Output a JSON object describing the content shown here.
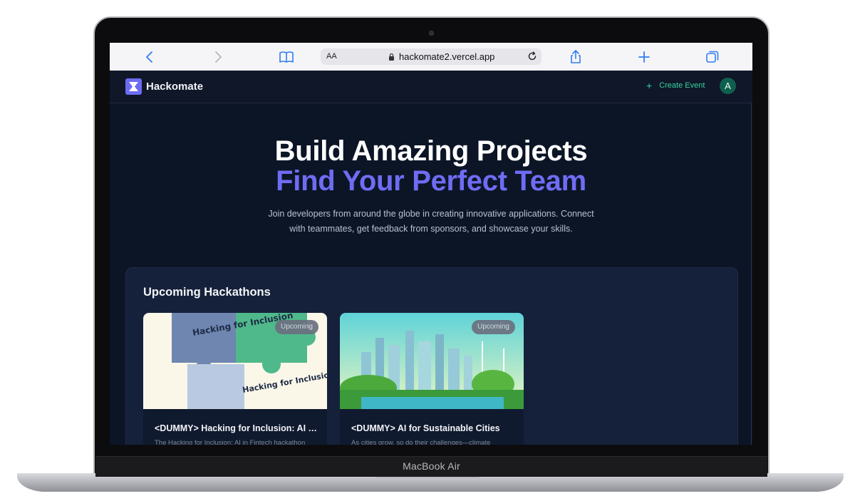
{
  "safari": {
    "aa_label": "AA",
    "url": "hackomate2.vercel.app"
  },
  "laptop": {
    "model_label": "MacBook Air"
  },
  "navbar": {
    "brand": "Hackomate",
    "create_event_label": "Create Event",
    "avatar_initial": "A"
  },
  "hero": {
    "title_line1": "Build Amazing Projects",
    "title_line2": "Find Your Perfect Team",
    "subtitle": "Join developers from around the globe in creating innovative applications. Connect with teammates, get feedback from sponsors, and showcase your skills."
  },
  "upcoming": {
    "heading": "Upcoming Hackathons",
    "cards": [
      {
        "badge": "Upcoming",
        "title": "<DUMMY> Hacking for Inclusion: AI in Fintech",
        "description": "The Hacking for Inclusion: AI in Fintech hackathon",
        "image_text_top": "Hacking for Inclusion",
        "image_text_bottom": "Hacking for Inclusion"
      },
      {
        "badge": "Upcoming",
        "title": "<DUMMY> AI for Sustainable Cities",
        "description": "As cities grow, so do their challenges—climate"
      }
    ]
  },
  "colors": {
    "accent": "#6f6cf4",
    "green": "#34d399",
    "page_bg": "#0c1526"
  }
}
